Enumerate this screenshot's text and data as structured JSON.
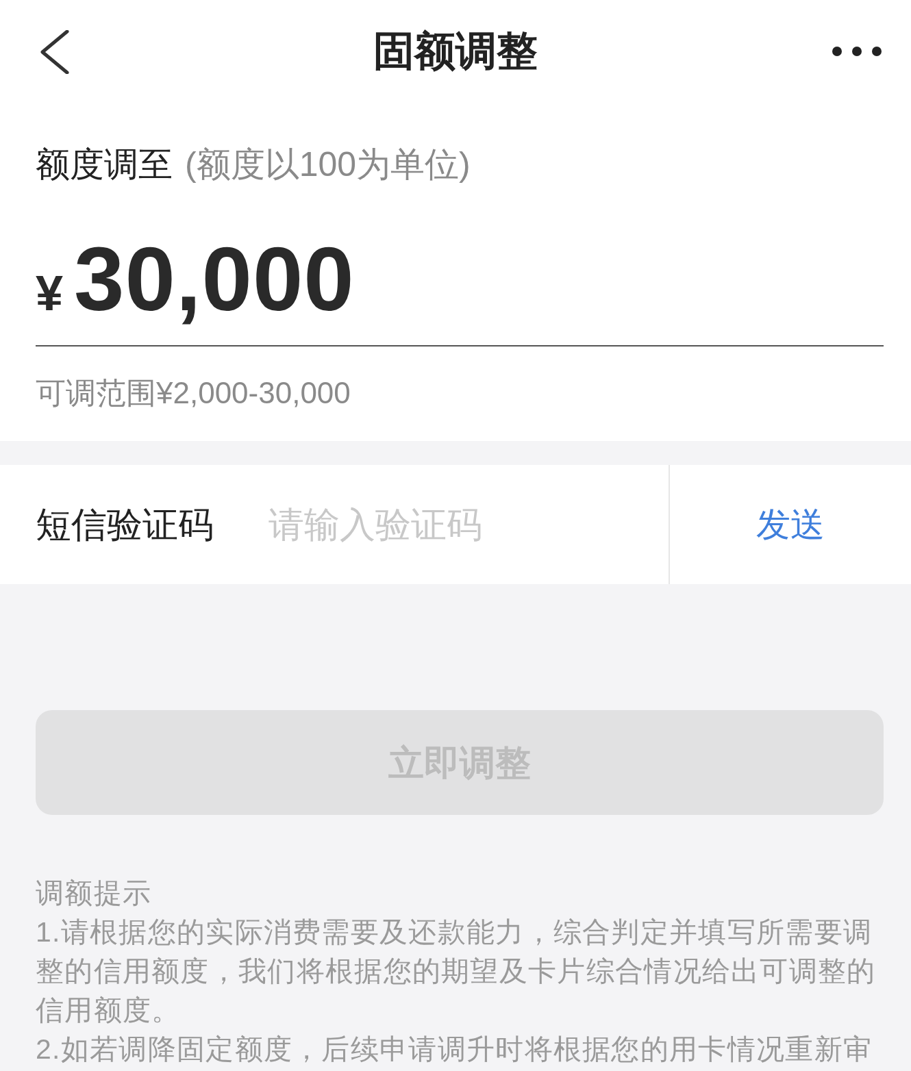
{
  "header": {
    "title": "固额调整"
  },
  "limit": {
    "label": "额度调至",
    "hint": "(额度以100为单位)",
    "currency": "¥",
    "value": "30,000",
    "range": "可调范围¥2,000-30,000"
  },
  "sms": {
    "label": "短信验证码",
    "placeholder": "请输入验证码",
    "send_button": "发送"
  },
  "submit": {
    "label": "立即调整",
    "disabled": true
  },
  "tips": {
    "title": "调额提示",
    "items": [
      "1.请根据您的实际消费需要及还款能力，综合判定并填写所需要调整的信用额度，我们将根据您的期望及卡片综合情况给出可调整的信用额度。",
      "2.如若调降固定额度，后续申请调升时将根据您的用卡情况重新审"
    ]
  }
}
